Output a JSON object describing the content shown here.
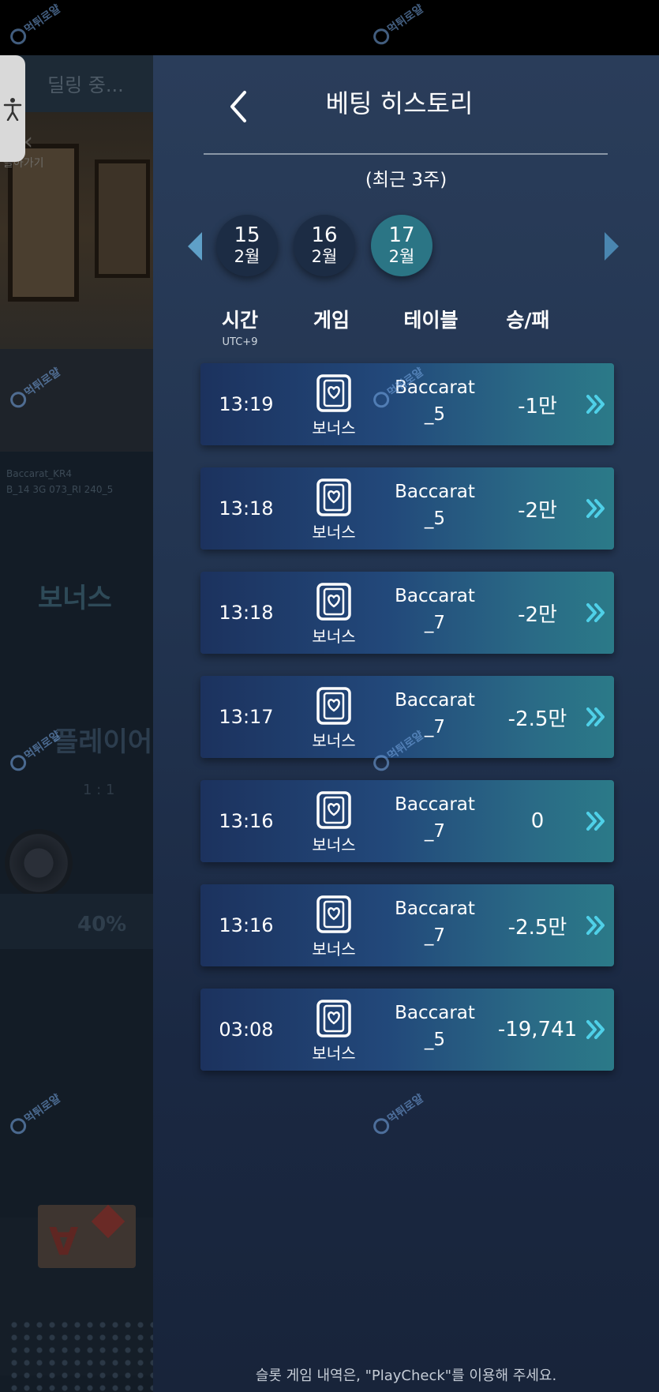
{
  "background": {
    "header_label": "딜링 중...",
    "back_label": "돌아가기",
    "small_text_lines": [
      "Baccarat_KR4",
      "B_14 3G 073_RI 240_5"
    ],
    "bonus_label": "보너스",
    "player_label": "플레이어",
    "ratio": "1 : 1",
    "percent": "40%",
    "card_rank": "A"
  },
  "panel": {
    "title": "베팅 히스토리",
    "period": "(최근 3주)",
    "dates": [
      {
        "day": "15",
        "month": "2월",
        "active": false
      },
      {
        "day": "16",
        "month": "2월",
        "active": false
      },
      {
        "day": "17",
        "month": "2월",
        "active": true
      }
    ],
    "columns": {
      "time": "시간",
      "time_sub": "UTC+9",
      "game": "게임",
      "table": "테이블",
      "result": "승/패"
    },
    "rows": [
      {
        "time": "13:19",
        "game": "보너스",
        "table_line1": "Baccarat",
        "table_line2": "_5",
        "result": "-1만"
      },
      {
        "time": "13:18",
        "game": "보너스",
        "table_line1": "Baccarat",
        "table_line2": "_5",
        "result": "-2만"
      },
      {
        "time": "13:18",
        "game": "보너스",
        "table_line1": "Baccarat",
        "table_line2": "_7",
        "result": "-2만"
      },
      {
        "time": "13:17",
        "game": "보너스",
        "table_line1": "Baccarat",
        "table_line2": "_7",
        "result": "-2.5만"
      },
      {
        "time": "13:16",
        "game": "보너스",
        "table_line1": "Baccarat",
        "table_line2": "_7",
        "result": "0"
      },
      {
        "time": "13:16",
        "game": "보너스",
        "table_line1": "Baccarat",
        "table_line2": "_7",
        "result": "-2.5만"
      },
      {
        "time": "03:08",
        "game": "보너스",
        "table_line1": "Baccarat",
        "table_line2": "_5",
        "result": "-19,741"
      }
    ],
    "footer_note": "슬롯 게임 내역은, \"PlayCheck\"를 이용해 주세요."
  },
  "watermark": "먹튀로얄",
  "icons": {
    "back": "chevron-left-icon",
    "prev": "triangle-left-icon",
    "next": "triangle-right-icon",
    "row_detail": "double-chevron-right-icon",
    "game": "card-heart-icon",
    "accessibility": "accessibility-icon"
  },
  "colors": {
    "panel_bg": "#223450",
    "active_date": "#2b7585",
    "chevron": "#4fd0e8",
    "nav_arrow": "#5fa0c8"
  }
}
